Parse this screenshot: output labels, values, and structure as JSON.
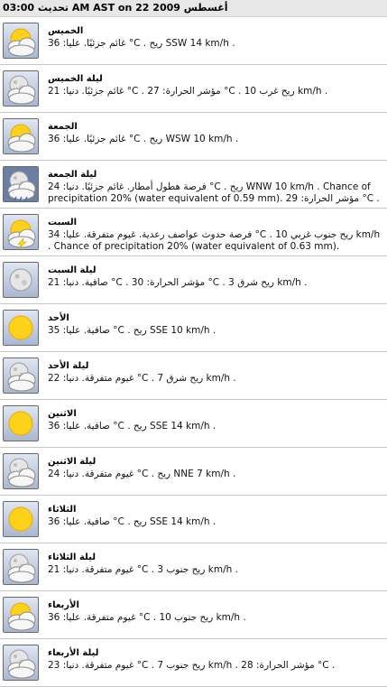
{
  "header": {
    "text": "تحديث 03:00 AM AST on 22 أغسطس 2009"
  },
  "rows": [
    {
      "day": "الخميس",
      "icon": "partly-cloudy-day-icon",
      "desc": "غائم جزئيًا. عليا: 36 °C . ريح SSW 14 km/h ."
    },
    {
      "day": "ليلة الخميس",
      "icon": "partly-cloudy-night-icon",
      "desc": "غائم جزئيًا. دنيا: 21 °C . مؤشر الحرارة: 27 °C . ريح غرب 10 km/h ."
    },
    {
      "day": "الجمعة",
      "icon": "partly-cloudy-day-icon",
      "desc": "غائم جزئيًا. عليا: 36 °C . ريح WSW 10 km/h ."
    },
    {
      "day": "ليلة الجمعة",
      "icon": "rain-night-icon",
      "desc": "فرصة هطول أمطار. غائم جزئيًا. دنيا: 24 °C . ريح WNW 10 km/h . Chance of precipitation 20% (water equivalent of 0.59 mm). مؤشر الحرارة: 29 °C ."
    },
    {
      "day": "السبت",
      "icon": "thunderstorm-icon",
      "desc": "فرصة حدوث عواصف رعدية. غيوم متفرقة. عليا: 34 °C . ريح جنوب غربي 10 km/h . Chance of precipitation 20% (water equivalent of 0.63 mm)."
    },
    {
      "day": "ليلة السبت",
      "icon": "clear-night-icon",
      "desc": "صافية. دنيا: 21 °C . مؤشر الحرارة: 30 °C . ريح شرق 3 km/h ."
    },
    {
      "day": "الأحد",
      "icon": "sunny-icon",
      "desc": "صافية. عليا: 35 °C . ريح SSE 10 km/h ."
    },
    {
      "day": "ليلة الأحد",
      "icon": "partly-cloudy-night-icon",
      "desc": "غيوم متفرقة. دنيا: 22 °C . ريح شرق 7 km/h ."
    },
    {
      "day": "الاثنين",
      "icon": "sunny-icon",
      "desc": "صافية. عليا: 36 °C . ريح SSE 14 km/h ."
    },
    {
      "day": "ليلة الاثنين",
      "icon": "partly-cloudy-night-icon",
      "desc": "غيوم متفرقة. دنيا: 24 °C . ريح NNE 7 km/h ."
    },
    {
      "day": "الثلاثاء",
      "icon": "sunny-icon",
      "desc": "صافية. عليا: 36 °C . ريح SSE 14 km/h ."
    },
    {
      "day": "ليلة الثلاثاء",
      "icon": "partly-cloudy-night-icon",
      "desc": "غيوم متفرقة. دنيا: 21 °C . ريح جنوب 3 km/h ."
    },
    {
      "day": "الأربعاء",
      "icon": "partly-cloudy-day-icon",
      "desc": "غيوم متفرقة. عليا: 36 °C . ريح جنوب 10 km/h ."
    },
    {
      "day": "ليلة الأربعاء",
      "icon": "partly-cloudy-night-icon",
      "desc": "غيوم متفرقة. دنيا: 23 °C . ريح جنوب 7 km/h . مؤشر الحرارة: 28 °C ."
    }
  ]
}
